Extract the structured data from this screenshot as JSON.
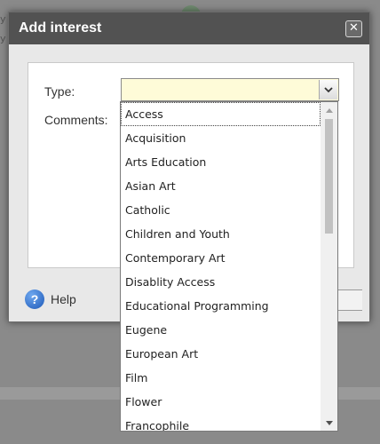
{
  "background": {
    "line1": "y",
    "line2": "y"
  },
  "dialog": {
    "title": "Add interest",
    "close_icon": "close-icon",
    "form": {
      "type_label": "Type:",
      "type_value": "",
      "comments_label": "Comments:"
    },
    "footer": {
      "help_label": "Help",
      "help_icon": "question-circle-icon"
    }
  },
  "dropdown": {
    "selected": "Access",
    "items": [
      "Access",
      "Acquisition",
      "Arts Education",
      "Asian Art",
      "Catholic",
      "Children and Youth",
      "Contemporary Art",
      "Disablity Access",
      "Educational Programming",
      "Eugene",
      "European Art",
      "Film",
      "Flower",
      "Francophile"
    ],
    "scroll_position": 0.0
  },
  "colors": {
    "header_bg": "#525252",
    "select_bg": "#fefbd8",
    "help_icon": "#1d58b8"
  }
}
